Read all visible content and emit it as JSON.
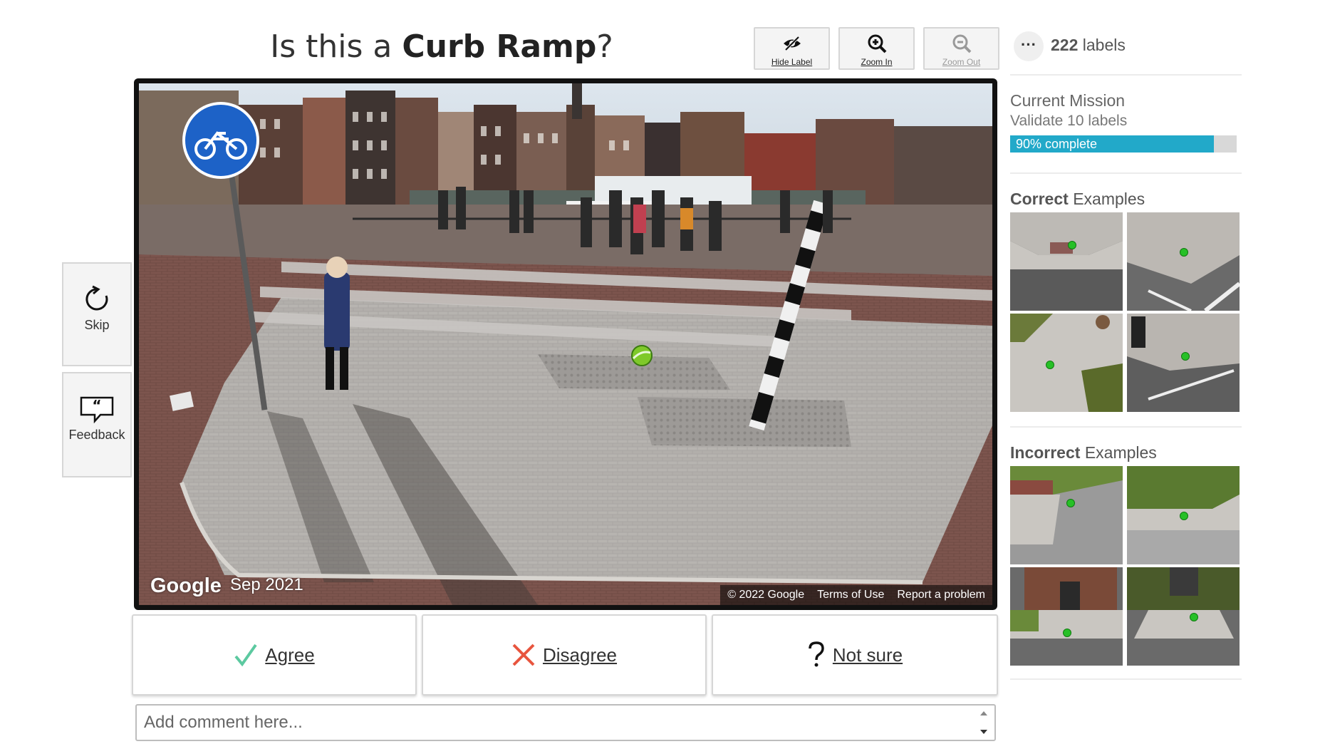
{
  "question": {
    "prefix": "Is this a ",
    "label_type": "Curb Ramp",
    "suffix": "?"
  },
  "toolbar": {
    "hide_label": "Hide Label",
    "zoom_in": "Zoom In",
    "zoom_out": "Zoom Out"
  },
  "side": {
    "skip": "Skip",
    "feedback": "Feedback"
  },
  "pano": {
    "logo": "Google",
    "date": "Sep 2021",
    "copyright": "© 2022 Google",
    "terms": "Terms of Use",
    "report": "Report a problem"
  },
  "actions": {
    "agree": "Agree",
    "disagree": "Disagree",
    "not_sure": "Not sure"
  },
  "comment": {
    "placeholder": "Add comment here..."
  },
  "sidebar": {
    "more": "···",
    "label_count": "222",
    "label_word": "labels",
    "mission_title": "Current Mission",
    "mission_subtitle": "Validate 10 labels",
    "progress_text": "90% complete",
    "progress_fraction": 0.9,
    "correct_bold": "Correct",
    "correct_rest": " Examples",
    "incorrect_bold": "Incorrect",
    "incorrect_rest": " Examples"
  },
  "colors": {
    "progress": "#22a9c9",
    "agree": "#5cc9a0",
    "disagree": "#e8553e",
    "label_dot": "#27c027"
  }
}
